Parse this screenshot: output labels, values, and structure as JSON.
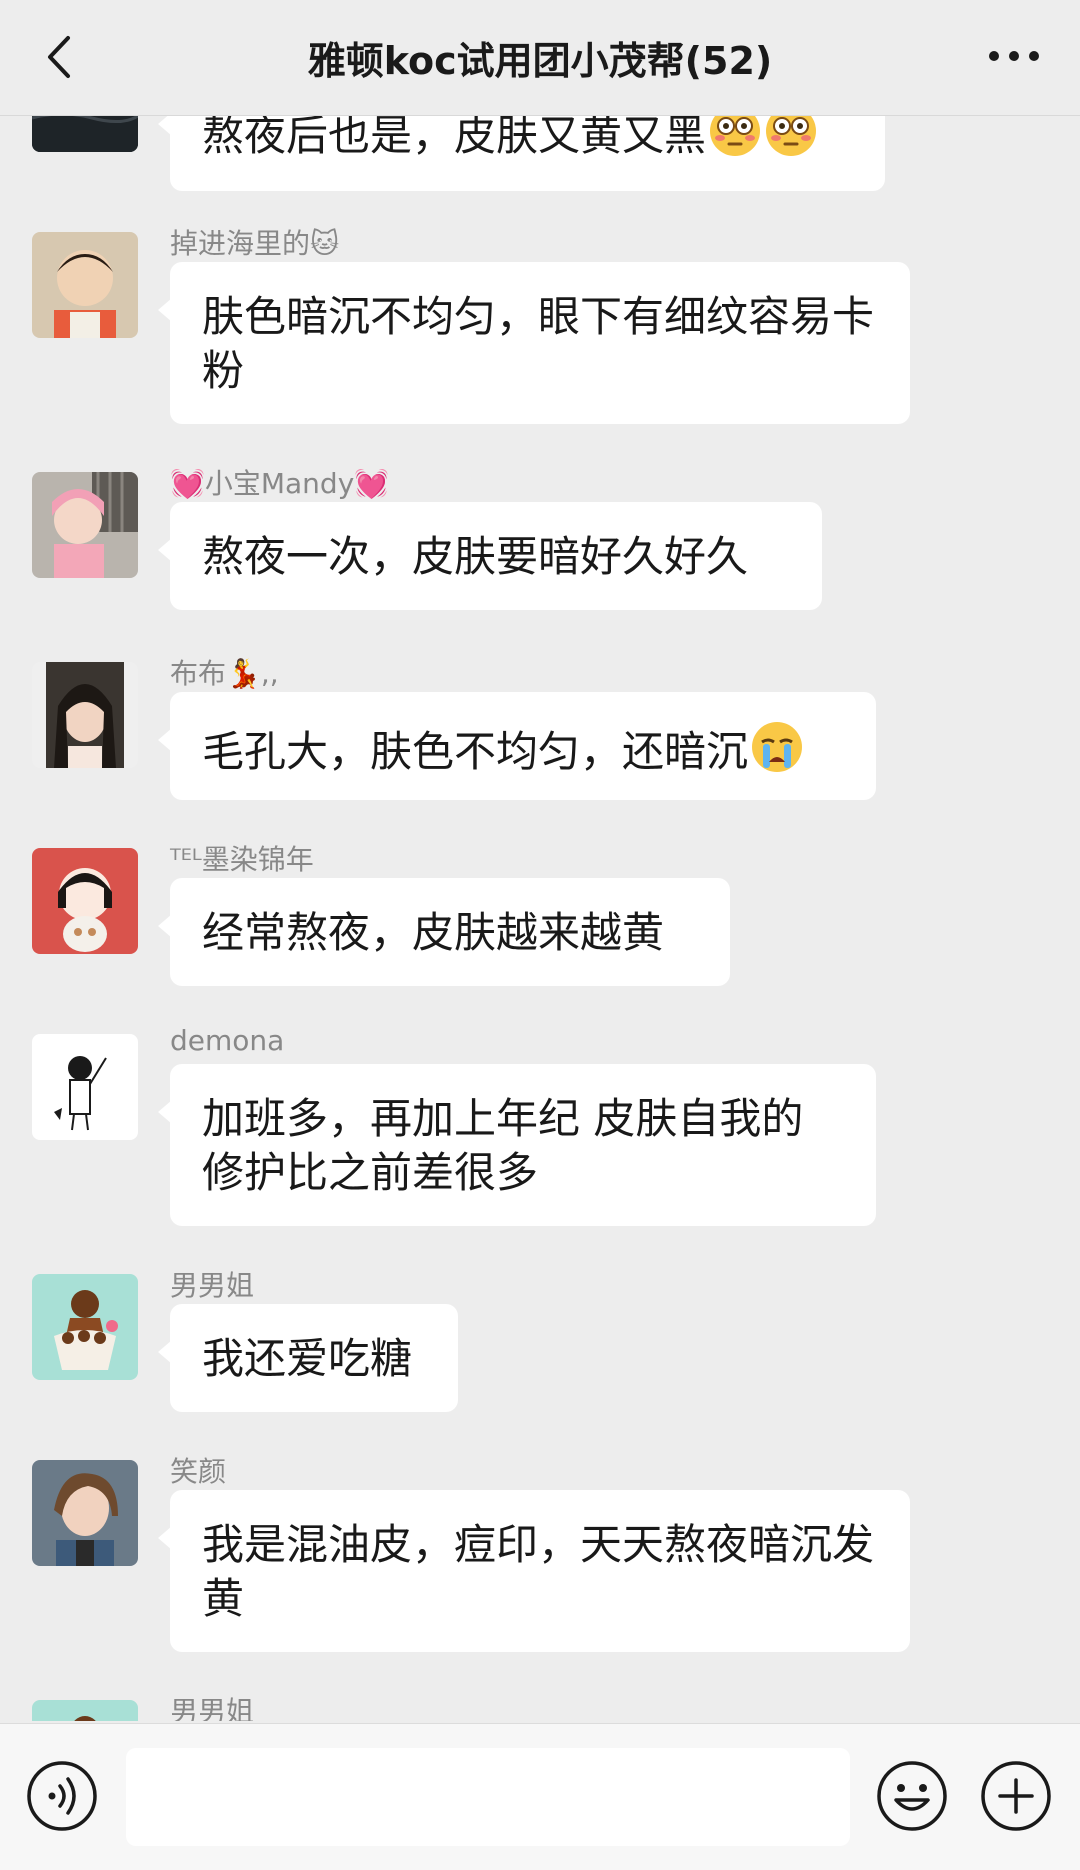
{
  "header": {
    "title": "雅顿koc试用团小茂帮(52)",
    "back_icon": "chevron-left-icon",
    "more_icon": "more-dots-icon"
  },
  "messages": [
    {
      "sender": "",
      "text": "熬夜后也是，皮肤又黄又黑",
      "emoji_count": 2,
      "emoji": "flushed-face-icon"
    },
    {
      "sender": "掉进海里的🐱",
      "text": "肤色暗沉不均匀，眼下有细纹容易卡粉"
    },
    {
      "sender": "💓小宝Mandy💓",
      "text": "熬夜一次，皮肤要暗好久好久"
    },
    {
      "sender": "布布💃,,",
      "text": "毛孔大，肤色不均匀，还暗沉",
      "emoji_count": 1,
      "emoji": "crying-face-icon"
    },
    {
      "sender": "ᵀᴱᴸ墨染锦年",
      "text": "经常熬夜，皮肤越来越黄"
    },
    {
      "sender": "demona",
      "text": "加班多，再加上年纪 皮肤自我的修护比之前差很多"
    },
    {
      "sender": "男男姐",
      "text": "我还爱吃糖"
    },
    {
      "sender": "笑颜",
      "text": "我是混油皮，痘印，天天熬夜暗沉发黄"
    },
    {
      "sender": "男男姐",
      "text": ""
    }
  ],
  "input_bar": {
    "voice_icon": "voice-icon",
    "input_value": "",
    "emoji_icon": "smiley-icon",
    "add_icon": "plus-circle-icon"
  },
  "colors": {
    "background": "#ededed",
    "bubble": "#ffffff",
    "sender_text": "#888888"
  }
}
